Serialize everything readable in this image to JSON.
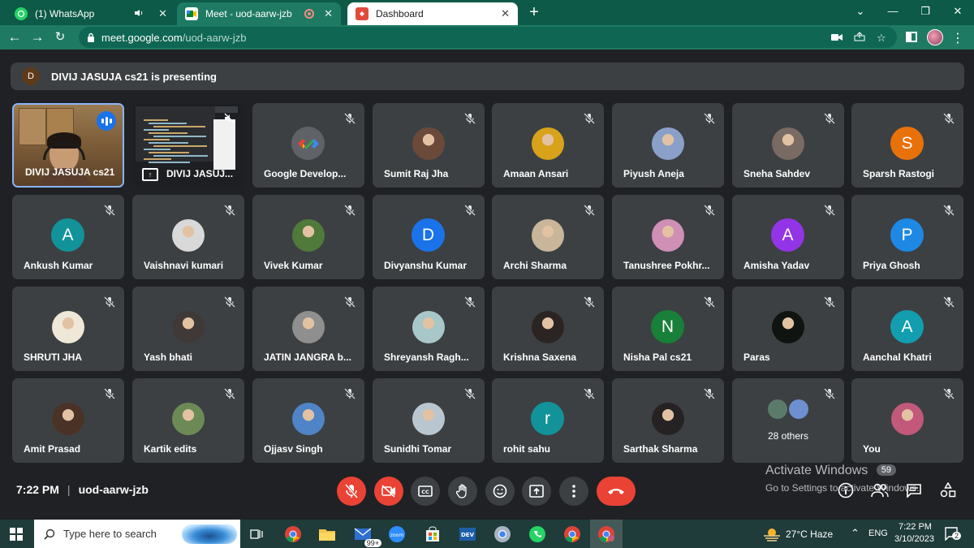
{
  "browser": {
    "tabs": [
      {
        "title": "(1) WhatsApp",
        "icon": "whatsapp-icon"
      },
      {
        "title": "Meet - uod-aarw-jzb",
        "icon": "meet-icon"
      },
      {
        "title": "Dashboard",
        "icon": "dashboard-icon"
      }
    ],
    "url_host": "meet.google.com",
    "url_path": "/uod-aarw-jzb"
  },
  "meet": {
    "presenter_initial": "D",
    "presenting_banner": "DIVIJ JASUJA cs21 is presenting",
    "tiles": [
      {
        "name": "DIVIJ JASUJA cs21",
        "kind": "camera"
      },
      {
        "name": "DIVIJ JASUJ...",
        "kind": "screen"
      },
      {
        "name": "Google Develop...",
        "kind": "logo"
      },
      {
        "name": "Sumit Raj Jha",
        "kind": "photo",
        "color": "#6b4a3a"
      },
      {
        "name": "Amaan Ansari",
        "kind": "photo",
        "color": "#d9a21b"
      },
      {
        "name": "Piyush Aneja",
        "kind": "photo",
        "color": "#8aa0c8"
      },
      {
        "name": "Sneha Sahdev",
        "kind": "photo",
        "color": "#7a6a64"
      },
      {
        "name": "Sparsh Rastogi",
        "kind": "letter",
        "letter": "S",
        "color": "#e8710a"
      },
      {
        "name": "Ankush Kumar",
        "kind": "letter",
        "letter": "A",
        "color": "#12939a"
      },
      {
        "name": "Vaishnavi kumari",
        "kind": "photo",
        "color": "#d9d9d9"
      },
      {
        "name": "Vivek Kumar",
        "kind": "photo",
        "color": "#4f7a3a"
      },
      {
        "name": "Divyanshu Kumar",
        "kind": "letter",
        "letter": "D",
        "color": "#1a73e8"
      },
      {
        "name": "Archi Sharma",
        "kind": "photo",
        "color": "#c9b59a"
      },
      {
        "name": "Tanushree Pokhr...",
        "kind": "photo",
        "color": "#d08fb5"
      },
      {
        "name": "Amisha Yadav",
        "kind": "letter",
        "letter": "A",
        "color": "#9334e6"
      },
      {
        "name": "Priya Ghosh",
        "kind": "letter",
        "letter": "P",
        "color": "#1e88e5"
      },
      {
        "name": "SHRUTI JHA",
        "kind": "photo",
        "color": "#efe7d7"
      },
      {
        "name": "Yash bhati",
        "kind": "photo",
        "color": "#3f3a38"
      },
      {
        "name": "JATIN JANGRA b...",
        "kind": "photo",
        "color": "#8f8f8f"
      },
      {
        "name": "Shreyansh Ragh...",
        "kind": "photo",
        "color": "#a7c7c9"
      },
      {
        "name": "Krishna Saxena",
        "kind": "photo",
        "color": "#2a2522"
      },
      {
        "name": "Nisha Pal cs21",
        "kind": "letter",
        "letter": "N",
        "color": "#188038"
      },
      {
        "name": "Paras",
        "kind": "photo",
        "color": "#101410"
      },
      {
        "name": "Aanchal Khatri",
        "kind": "letter",
        "letter": "A",
        "color": "#129eaf"
      },
      {
        "name": "Amit Prasad",
        "kind": "photo",
        "color": "#4a3326"
      },
      {
        "name": "Kartik edits",
        "kind": "photo",
        "color": "#6c8a55"
      },
      {
        "name": "Ojjasv Singh",
        "kind": "photo",
        "color": "#4f84c6"
      },
      {
        "name": "Sunidhi Tomar",
        "kind": "photo",
        "color": "#b9c6d0"
      },
      {
        "name": "rohit sahu",
        "kind": "letter",
        "letter": "r",
        "color": "#12939a"
      },
      {
        "name": "Sarthak Sharma",
        "kind": "photo",
        "color": "#262223"
      },
      {
        "name": "28 others",
        "kind": "others"
      },
      {
        "name": "You",
        "kind": "photo",
        "color": "#c2587a"
      }
    ],
    "time": "7:22 PM",
    "meeting_code": "uod-aarw-jzb"
  },
  "windows_overlay": {
    "activate_title": "Activate Windows",
    "activate_sub": "Go to Settings to activate Windows.",
    "chat_badge": "59"
  },
  "taskbar": {
    "search_placeholder": "Type here to search",
    "weather": "27°C  Haze",
    "lang": "ENG",
    "time": "7:22 PM",
    "date": "3/10/2023",
    "mail_badge": "99+",
    "notif_count": "2"
  }
}
